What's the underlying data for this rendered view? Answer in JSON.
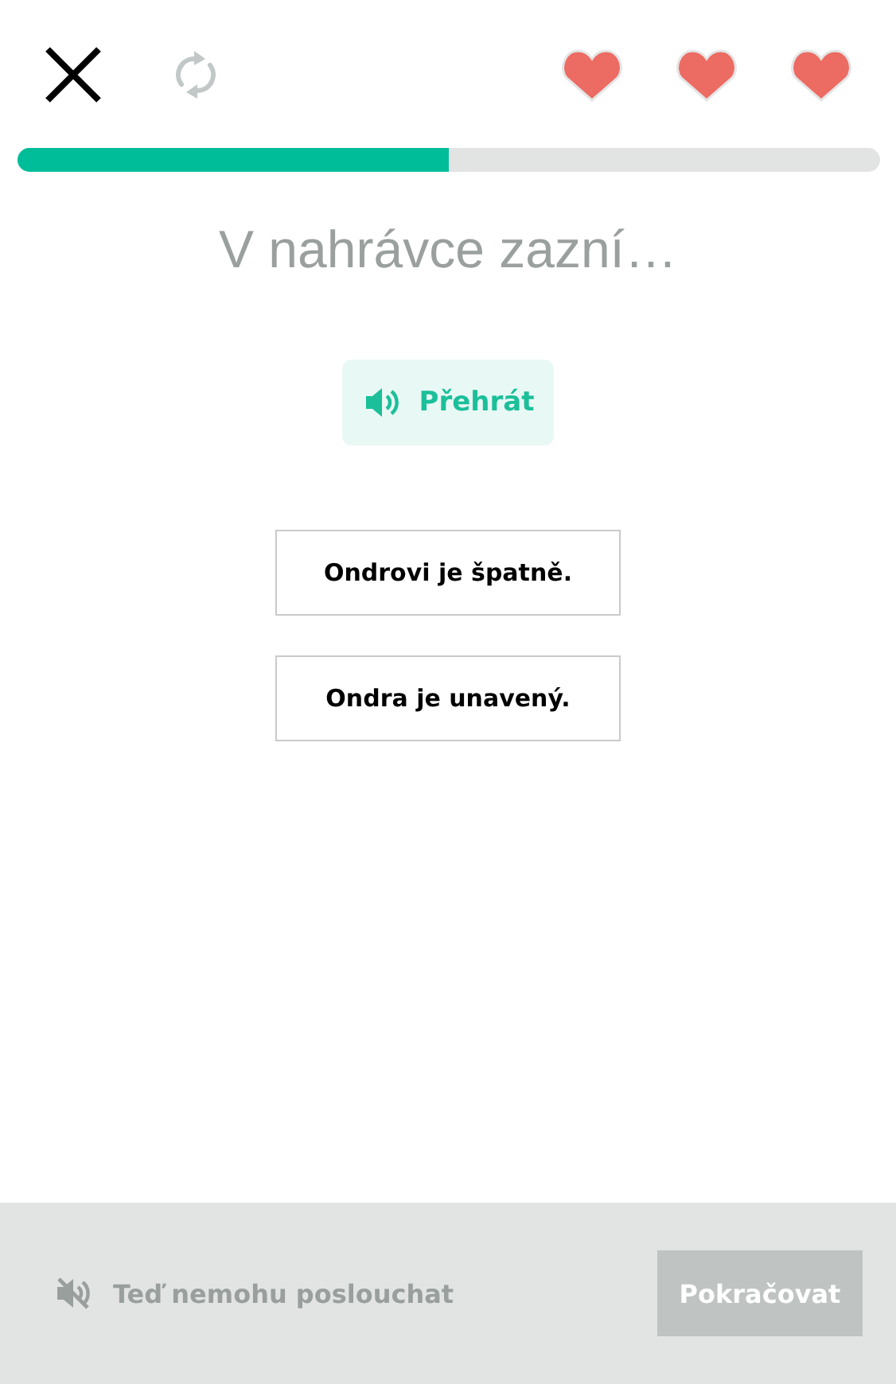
{
  "hearts": [
    {
      "filled": true
    },
    {
      "filled": true
    },
    {
      "filled": true
    }
  ],
  "progress": {
    "level": 0.5
  },
  "prompt": "V nahrávce zazní…",
  "play_button": "Přehrát",
  "options": [
    {
      "label": "Ondrovi je špatně.",
      "selected": false
    },
    {
      "label": "Ondra je unavený.",
      "selected": false
    }
  ],
  "footer": {
    "cant_listen": "Teď nemohu poslouchat",
    "continue_button": "Pokračovat",
    "continue_disabled": true
  }
}
